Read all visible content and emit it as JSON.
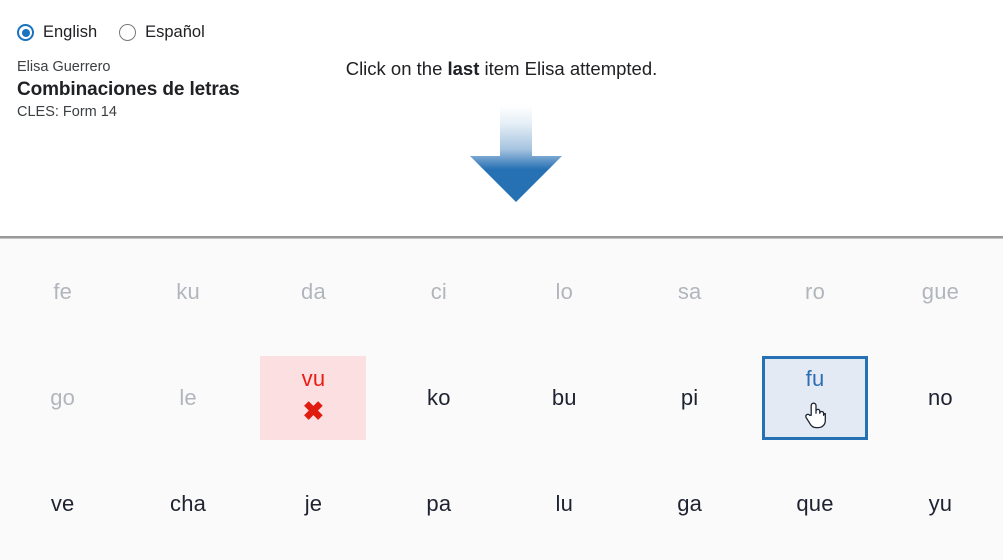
{
  "language_selector": {
    "options": [
      {
        "label": "English",
        "selected": true
      },
      {
        "label": "Español",
        "selected": false
      }
    ]
  },
  "header": {
    "student_name": "Elisa Guerrero",
    "assessment_title": "Combinaciones de letras",
    "form_label": "CLES: Form 14",
    "instruction_prefix": "Click on the ",
    "instruction_emphasis": "last",
    "instruction_suffix": " item Elisa attempted.",
    "arrow_icon": "down-arrow-icon"
  },
  "colors": {
    "accent_blue": "#2670b4",
    "arrow_gradient_top": "#fbfdfe",
    "arrow_gradient_bottom": "#2670b4",
    "selected_fill": "#e3eaf3",
    "incorrect_fill": "#fbdfe1",
    "incorrect_text": "#ec1c14",
    "dimmed_text": "#b2b6bc",
    "normal_text": "#1f2230",
    "panel_background": "#fafafa"
  },
  "item_grid": {
    "columns": 8,
    "rows": [
      [
        {
          "text": "fe",
          "state": "dimmed"
        },
        {
          "text": "ku",
          "state": "dimmed"
        },
        {
          "text": "da",
          "state": "dimmed"
        },
        {
          "text": "ci",
          "state": "dimmed"
        },
        {
          "text": "lo",
          "state": "dimmed"
        },
        {
          "text": "sa",
          "state": "dimmed"
        },
        {
          "text": "ro",
          "state": "dimmed"
        },
        {
          "text": "gue",
          "state": "dimmed"
        }
      ],
      [
        {
          "text": "go",
          "state": "dimmed"
        },
        {
          "text": "le",
          "state": "dimmed"
        },
        {
          "text": "vu",
          "state": "incorrect",
          "mark": "✖"
        },
        {
          "text": "ko",
          "state": "normal"
        },
        {
          "text": "bu",
          "state": "normal"
        },
        {
          "text": "pi",
          "state": "normal"
        },
        {
          "text": "fu",
          "state": "selected",
          "cursor": "hand-pointer-cursor"
        },
        {
          "text": "no",
          "state": "normal"
        }
      ],
      [
        {
          "text": "ve",
          "state": "normal"
        },
        {
          "text": "cha",
          "state": "normal"
        },
        {
          "text": "je",
          "state": "normal"
        },
        {
          "text": "pa",
          "state": "normal"
        },
        {
          "text": "lu",
          "state": "normal"
        },
        {
          "text": "ga",
          "state": "normal"
        },
        {
          "text": "que",
          "state": "normal"
        },
        {
          "text": "yu",
          "state": "normal"
        }
      ]
    ]
  }
}
